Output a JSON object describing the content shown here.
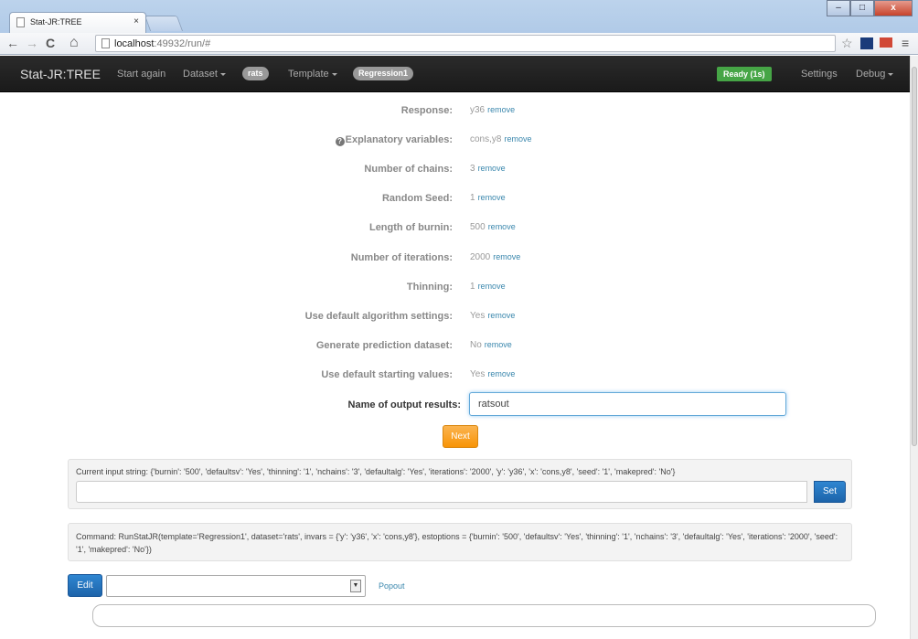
{
  "browser": {
    "tab_title": "Stat-JR:TREE",
    "tab_close": "×",
    "url_host": "localhost",
    "url_rest": ":49932/run/#",
    "window_buttons": [
      "–",
      "□",
      "x"
    ]
  },
  "navbar": {
    "brand": "Stat-JR:TREE",
    "start_again": "Start again",
    "dataset_menu": "Dataset",
    "dataset_badge": "rats",
    "template_menu": "Template",
    "template_badge": "Regression1",
    "status": "Ready (1s)",
    "settings": "Settings",
    "debug": "Debug"
  },
  "form": {
    "remove_label": "remove",
    "rows": [
      {
        "label": "Response:",
        "value": "y36"
      },
      {
        "label": "Explanatory variables:",
        "value": "cons,y8"
      },
      {
        "label": "Number of chains:",
        "value": "3"
      },
      {
        "label": "Random Seed:",
        "value": "1"
      },
      {
        "label": "Length of burnin:",
        "value": "500"
      },
      {
        "label": "Number of iterations:",
        "value": "2000"
      },
      {
        "label": "Thinning:",
        "value": "1"
      },
      {
        "label": "Use default algorithm settings:",
        "value": "Yes"
      },
      {
        "label": "Generate prediction dataset:",
        "value": "No"
      },
      {
        "label": "Use default starting values:",
        "value": "Yes"
      }
    ],
    "output_label": "Name of output results:",
    "output_value": "ratsout",
    "next_label": "Next"
  },
  "input_string": {
    "text": "Current input string: {'burnin': '500', 'defaultsv': 'Yes', 'thinning': '1', 'nchains': '3', 'defaultalg': 'Yes', 'iterations': '2000', 'y': 'y36', 'x': 'cons,y8', 'seed': '1', 'makepred': 'No'}",
    "set_label": "Set"
  },
  "command": {
    "text": "Command: RunStatJR(template='Regression1', dataset='rats', invars = {'y': 'y36', 'x': 'cons,y8'}, estoptions = {'burnin': '500', 'defaultsv': 'Yes', 'thinning': '1', 'nchains': '3', 'defaultalg': 'Yes', 'iterations': '2000', 'seed': '1', 'makepred': 'No'})"
  },
  "editor": {
    "edit_label": "Edit",
    "select_value": "",
    "popout_label": "Popout"
  },
  "icons": {
    "back": "←",
    "forward": "→",
    "reload": "C",
    "home": "⌂",
    "star": "☆",
    "menu": "≡",
    "help": "?"
  },
  "colors": {
    "navbar_bg": "#1f1f1f",
    "ready_badge": "#46a546",
    "next_button": "#f89406",
    "primary_button": "#1d64aa",
    "link": "#3a87ad"
  }
}
